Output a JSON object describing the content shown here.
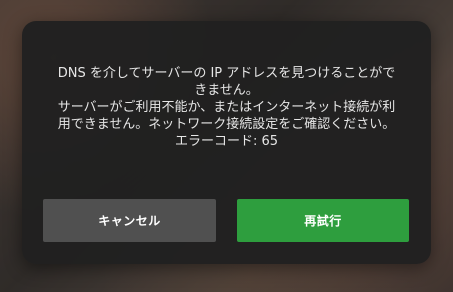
{
  "dialog": {
    "message_lines": [
      "DNS を介してサーバーの IP アドレスを見つけることがで",
      "きません。",
      "サーバーがご利用不能か、またはインターネット接続が利",
      "用できません。ネットワーク接続設定をご確認ください。",
      "エラーコード: 65"
    ],
    "cancel_label": "キャンセル",
    "retry_label": "再試行"
  },
  "colors": {
    "dialog_background": "#202020",
    "cancel_button": "#505050",
    "retry_button": "#2e9e3e",
    "text": "#e6e6e6"
  }
}
